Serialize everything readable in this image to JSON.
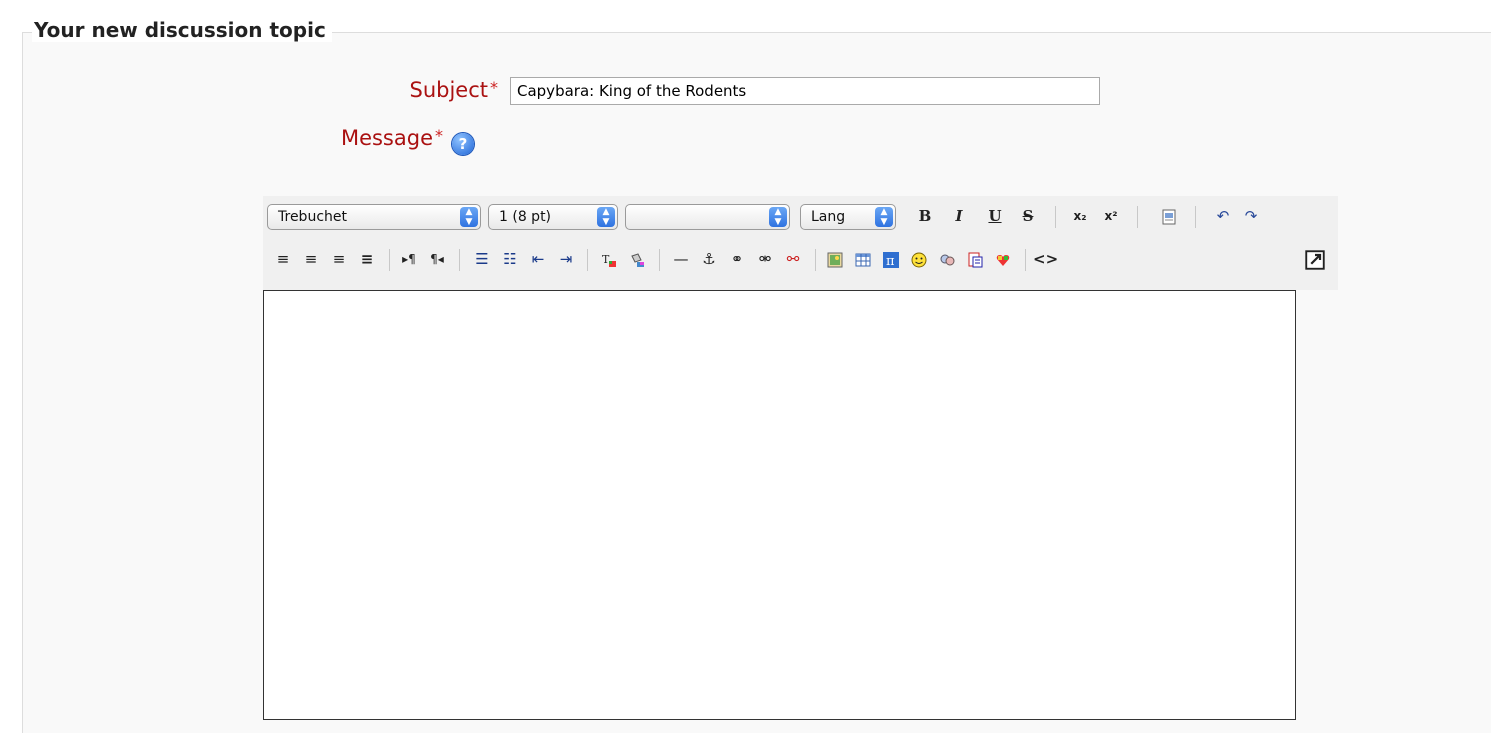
{
  "legend": "Your new discussion topic",
  "subject": {
    "label": "Subject",
    "required_mark": "*",
    "value": "Capybara: King of the Rodents"
  },
  "message": {
    "label": "Message",
    "required_mark": "*",
    "help_glyph": "?"
  },
  "toolbar": {
    "font_family": "Trebuchet",
    "font_size": "1 (8 pt)",
    "format": "",
    "lang": "Lang",
    "bold": "B",
    "italic": "I",
    "underline": "U",
    "strike": "S",
    "subscript": "x₂",
    "superscript": "x²"
  },
  "colors": {
    "label_red": "#aa1111",
    "accent_blue": "#2f72e0"
  },
  "icons": [
    "paste-word-icon",
    "undo-icon",
    "redo-icon",
    "align-left-icon",
    "align-center-icon",
    "align-right-icon",
    "justify-icon",
    "ltr-icon",
    "rtl-icon",
    "ordered-list-icon",
    "unordered-list-icon",
    "outdent-icon",
    "indent-icon",
    "text-color-icon",
    "bg-color-icon",
    "horizontal-rule-icon",
    "anchor-icon",
    "link-icon",
    "unlink-icon",
    "nolink-icon",
    "image-icon",
    "table-icon",
    "tex-icon",
    "smiley-icon",
    "search-replace-icon",
    "insert-char-icon",
    "spellcheck-icon",
    "html-source-icon",
    "fullscreen-icon"
  ]
}
